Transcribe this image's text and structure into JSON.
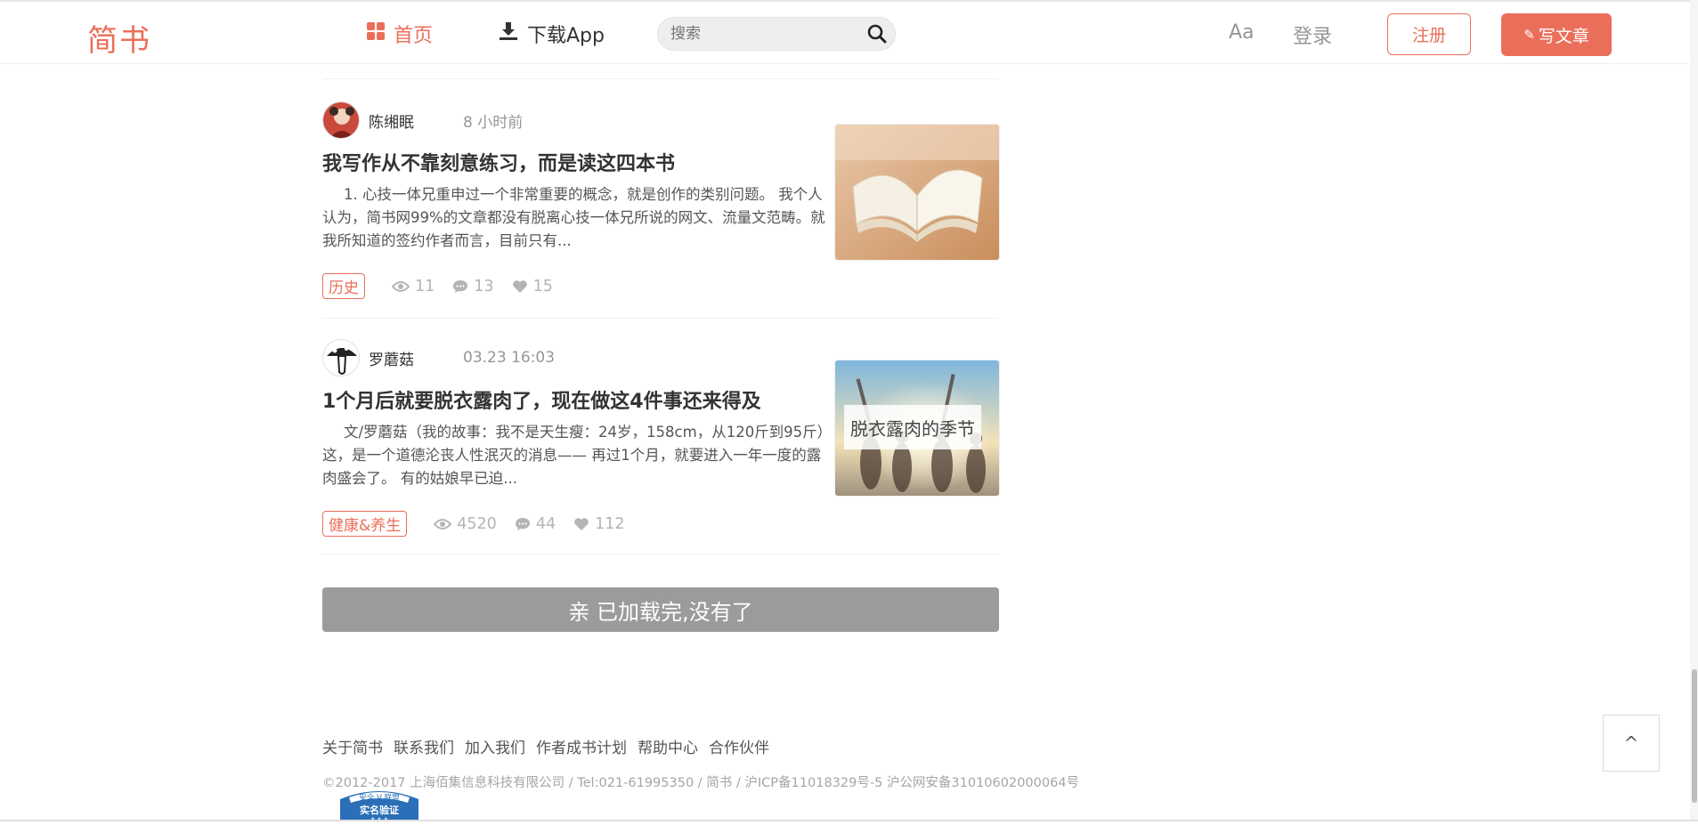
{
  "header": {
    "logo": "简书",
    "nav_home": "首页",
    "nav_app": "下载App",
    "search_placeholder": "搜索",
    "font_toggle": "Aa",
    "login": "登录",
    "signup": "注册",
    "write": "写文章"
  },
  "articles": [
    {
      "author": "陈缃眠",
      "time": "8 小时前",
      "title": "我写作从不靠刻意练习，而是读这四本书",
      "abstract": "1. 心技一体兄重申过一个非常重要的概念，就是创作的类别问题。 我个人认为，简书网99%的文章都没有脱离心技一体兄所说的网文、流量文范畴。就我所知道的签约作者而言，目前只有...",
      "tag": "历史",
      "views": "11",
      "comments": "13",
      "likes": "15"
    },
    {
      "author": "罗蘑菇",
      "time": "03.23 16:03",
      "title": "1个月后就要脱衣露肉了，现在做这4件事还来得及",
      "abstract": "文/罗蘑菇（我的故事：我不是天生瘦：24岁，158cm，从120斤到95斤）这，是一个道德沦丧人性泯灭的消息—— 再过1个月，就要进入一年一度的露肉盛会了。 有的姑娘早已迫...",
      "tag": "健康&养生",
      "views": "4520",
      "comments": "44",
      "likes": "112",
      "thumb_caption": "脱衣露肉的季节"
    }
  ],
  "load_more": "亲 已加载完,没有了",
  "footer": {
    "links": [
      "关于简书",
      "联系我们",
      "加入我们",
      "作者成书计划",
      "帮助中心",
      "合作伙伴"
    ],
    "copyright": "©2012-2017 上海佰集信息科技有限公司 / Tel:021-61995350 / 简书 / 沪ICP备11018329号-5 沪公网安备31010602000064号",
    "badge_line1": "安全 V 联盟",
    "badge_line2": "实名验证"
  },
  "back_to_top": "^",
  "colors": {
    "brand": "#ea6f5a",
    "load_more_bg": "#9b9b9b"
  }
}
